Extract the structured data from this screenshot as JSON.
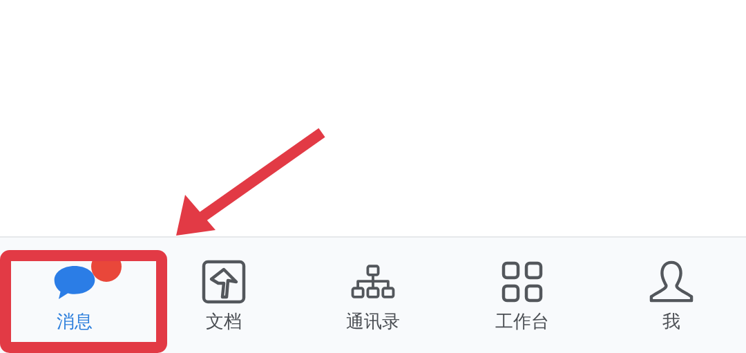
{
  "tab_bar": {
    "tabs": [
      {
        "label": "消息",
        "kind": "chat",
        "selected": true,
        "unread": true
      },
      {
        "label": "文档",
        "kind": "document",
        "selected": false,
        "unread": false
      },
      {
        "label": "通讯录",
        "kind": "org",
        "selected": false,
        "unread": false
      },
      {
        "label": "工作台",
        "kind": "grid",
        "selected": false,
        "unread": false
      },
      {
        "label": "我",
        "kind": "person",
        "selected": false,
        "unread": false
      }
    ]
  }
}
